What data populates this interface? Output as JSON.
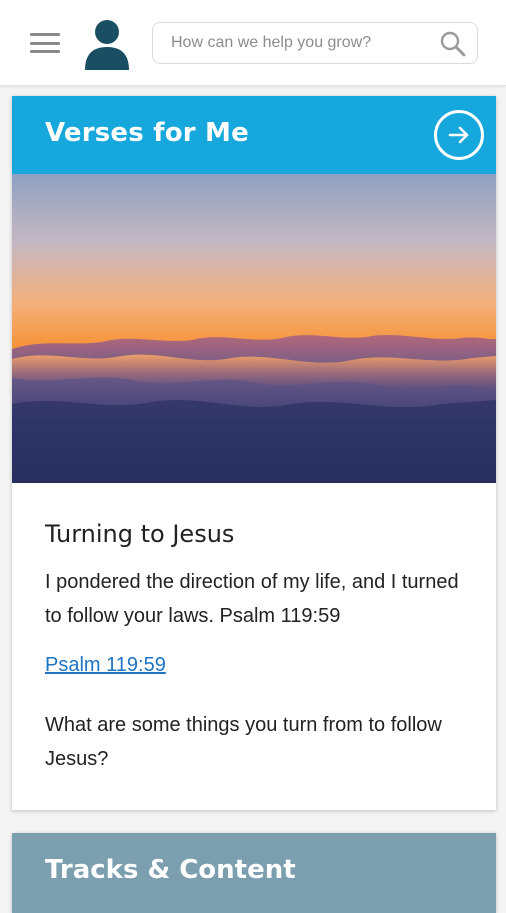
{
  "header": {
    "menu_icon": "hamburger-menu-icon",
    "avatar_icon": "user-avatar-icon",
    "search": {
      "placeholder": "How can we help you grow?",
      "value": "",
      "icon": "search-icon"
    }
  },
  "verses_card": {
    "title": "Verses for Me",
    "header_color": "#16a7dd",
    "action_icon": "arrow-right-circle-icon",
    "image": "sunset-clouds-image",
    "verse_title": "Turning to Jesus",
    "verse_text": "I pondered the direction of my life, and I turned to follow your laws. Psalm 119:59",
    "link_text": "Psalm 119:59",
    "question": "What are some things you turn from to follow Jesus?"
  },
  "tracks_card": {
    "title": "Tracks & Content",
    "header_color": "#7c9faf"
  }
}
